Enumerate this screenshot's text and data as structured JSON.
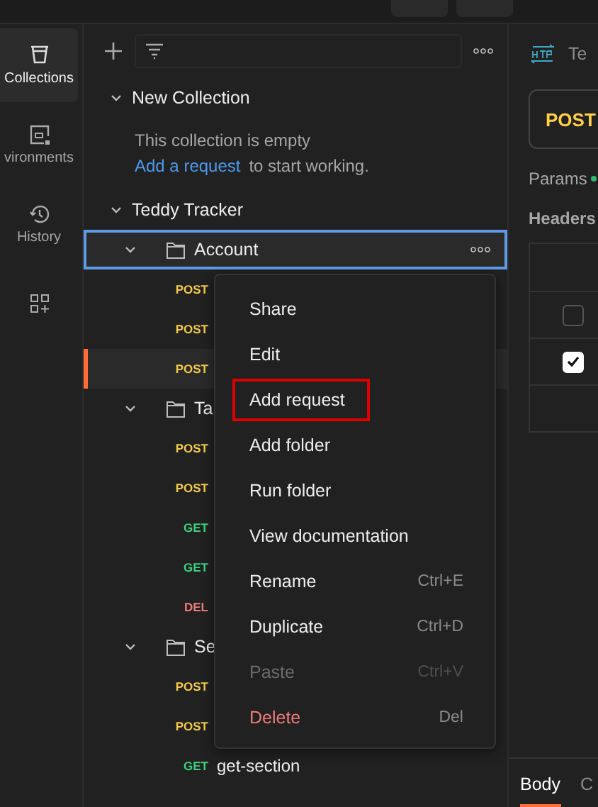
{
  "rail": [
    {
      "label": "Collections",
      "selected": true
    },
    {
      "label": "vironments",
      "selected": false
    },
    {
      "label": "History",
      "selected": false
    }
  ],
  "collections": [
    {
      "name": "New Collection",
      "expanded": true,
      "empty_text": "This collection is empty",
      "link": "Add a request",
      "link_rest": "to start working."
    },
    {
      "name": "Teddy Tracker",
      "expanded": true,
      "folders": [
        {
          "name": "Account",
          "expanded": true,
          "focused": true,
          "requests": [
            {
              "method": "POST",
              "selected": false
            },
            {
              "method": "POST",
              "selected": false
            },
            {
              "method": "POST",
              "selected": true
            }
          ]
        },
        {
          "name": "Ta",
          "expanded": true,
          "focused": false,
          "requests": [
            {
              "method": "POST",
              "selected": false
            },
            {
              "method": "POST",
              "selected": false
            },
            {
              "method": "GET",
              "selected": false
            },
            {
              "method": "GET",
              "selected": false
            },
            {
              "method": "DEL",
              "selected": false
            }
          ]
        },
        {
          "name": "Se",
          "expanded": true,
          "focused": false,
          "requests": [
            {
              "method": "POST",
              "selected": false
            },
            {
              "method": "POST",
              "selected": false
            },
            {
              "method": "GET",
              "name": "get-section",
              "selected": false
            }
          ]
        }
      ]
    }
  ],
  "menu": [
    {
      "label": "Share",
      "kind": "normal",
      "highlighted": false
    },
    {
      "label": "Edit",
      "kind": "normal",
      "highlighted": false
    },
    {
      "label": "Add request",
      "kind": "normal",
      "highlighted": true
    },
    {
      "label": "Add folder",
      "kind": "normal",
      "highlighted": false
    },
    {
      "label": "Run folder",
      "kind": "normal",
      "highlighted": false
    },
    {
      "label": "View documentation",
      "kind": "normal",
      "highlighted": false
    },
    {
      "label": "Rename",
      "shortcut": "Ctrl+E",
      "kind": "normal",
      "highlighted": false
    },
    {
      "label": "Duplicate",
      "shortcut": "Ctrl+D",
      "kind": "normal",
      "highlighted": false
    },
    {
      "label": "Paste",
      "shortcut": "Ctrl+V",
      "kind": "disabled",
      "highlighted": false
    },
    {
      "label": "Delete",
      "shortcut": "Del",
      "kind": "danger",
      "highlighted": false
    }
  ],
  "request": {
    "tab_title": "Te",
    "method": "POST",
    "tabs": [
      "Params",
      "Headers"
    ],
    "header_rows": [
      {
        "checked": false
      },
      {
        "checked": true
      }
    ],
    "bottom_tabs": [
      {
        "label": "Body",
        "selected": true
      },
      {
        "label": "C",
        "selected": false
      }
    ]
  }
}
